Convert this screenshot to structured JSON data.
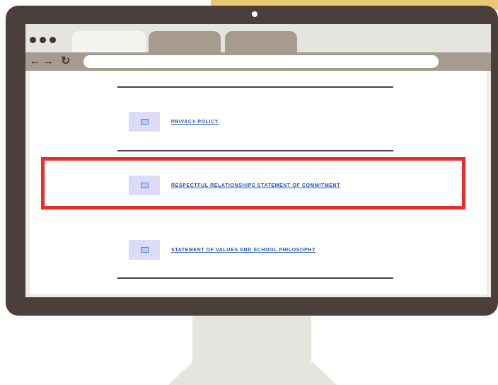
{
  "browser": {
    "nav": {
      "back_icon": "arrow-left-icon",
      "forward_icon": "arrow-right-icon",
      "reload_icon": "reload-icon",
      "back_glyph": "←",
      "forward_glyph": "→",
      "reload_glyph": "↻"
    },
    "address": ""
  },
  "documents": [
    {
      "label": "PRIVACY POLICY",
      "icon": "document-icon"
    },
    {
      "label": "RESPECTFUL RELATIONSHIPS STATEMENT OF COMMITMENT",
      "icon": "document-icon",
      "highlighted": true
    },
    {
      "label": "STATEMENT OF VALUES AND SCHOOL PHILOSOPHY",
      "icon": "document-icon"
    }
  ],
  "colors": {
    "highlight": "#ee2b2b",
    "link": "#1f55b6",
    "monitor_frame": "#4a3f3a",
    "accent": "#e8c872"
  }
}
